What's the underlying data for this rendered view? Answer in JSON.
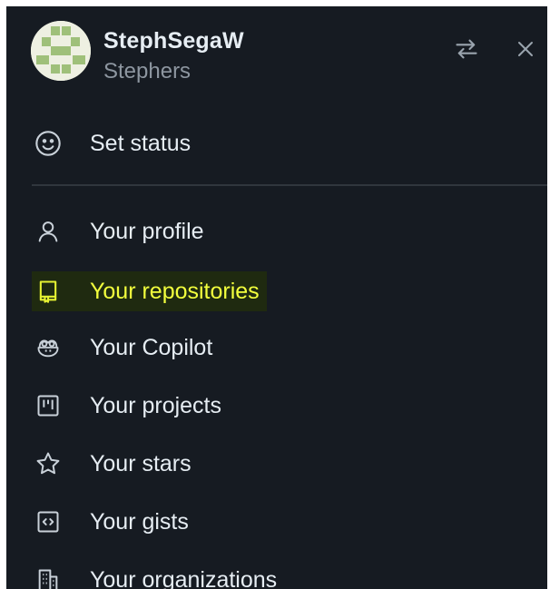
{
  "user": {
    "display_name": "StephSegaW",
    "login": "Stephers"
  },
  "header_icons": {
    "switch": "switch-account-icon",
    "close": "close-icon"
  },
  "status": {
    "label": "Set status",
    "icon": "smiley-icon"
  },
  "menu": {
    "items": [
      {
        "label": "Your profile",
        "icon": "person-icon"
      },
      {
        "label": "Your repositories",
        "icon": "repo-icon",
        "highlighted": true
      },
      {
        "label": "Your Copilot",
        "icon": "copilot-icon"
      },
      {
        "label": "Your projects",
        "icon": "project-icon"
      },
      {
        "label": "Your stars",
        "icon": "star-icon"
      },
      {
        "label": "Your gists",
        "icon": "code-square-icon"
      },
      {
        "label": "Your organizations",
        "icon": "organization-icon"
      }
    ]
  },
  "colors": {
    "background": "#161b22",
    "text": "#e6edf3",
    "muted": "#8d96a0",
    "highlight_text": "#f2ff3d",
    "highlight_bg": "#1f2a10"
  }
}
